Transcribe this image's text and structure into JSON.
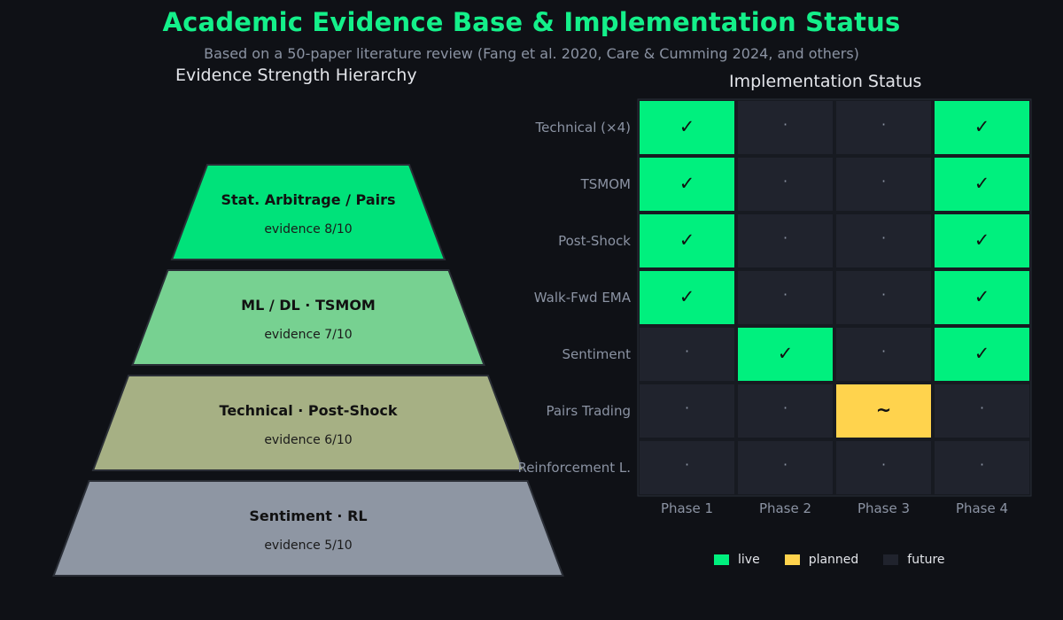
{
  "header": {
    "title": "Academic Evidence Base & Implementation Status",
    "subtitle": "Based on a 50-paper literature review (Fang et al. 2020, Care & Cumming 2024, and others)"
  },
  "pyramid": {
    "title": "Evidence Strength Hierarchy",
    "tiers": [
      {
        "label": "Stat. Arbitrage / Pairs",
        "evidence": "evidence 8/10",
        "color": "#00e27a"
      },
      {
        "label": "ML / DL · TSMOM",
        "evidence": "evidence 7/10",
        "color": "#77d191"
      },
      {
        "label": "Technical · Post-Shock",
        "evidence": "evidence 6/10",
        "color": "#a6b084"
      },
      {
        "label": "Sentiment · RL",
        "evidence": "evidence 5/10",
        "color": "#8e96a3"
      }
    ]
  },
  "grid": {
    "title": "Implementation Status",
    "rows": [
      "Technical (×4)",
      "TSMOM",
      "Post-Shock",
      "Walk-Fwd EMA",
      "Sentiment",
      "Pairs Trading",
      "Reinforcement L."
    ],
    "columns": [
      "Phase 1",
      "Phase 2",
      "Phase 3",
      "Phase 4"
    ],
    "status": [
      [
        "live",
        "future",
        "future",
        "live"
      ],
      [
        "live",
        "future",
        "future",
        "live"
      ],
      [
        "live",
        "future",
        "future",
        "live"
      ],
      [
        "live",
        "future",
        "future",
        "live"
      ],
      [
        "future",
        "live",
        "future",
        "live"
      ],
      [
        "future",
        "future",
        "planned",
        "future"
      ],
      [
        "future",
        "future",
        "future",
        "future"
      ]
    ],
    "symbols": {
      "live": "✓",
      "planned": "~",
      "future": "·"
    },
    "colors": {
      "live": "#00f07e",
      "planned": "#ffd34d",
      "future": "#20232d"
    }
  },
  "legend": [
    {
      "key": "live",
      "label": "live"
    },
    {
      "key": "planned",
      "label": "planned"
    },
    {
      "key": "future",
      "label": "future"
    }
  ]
}
